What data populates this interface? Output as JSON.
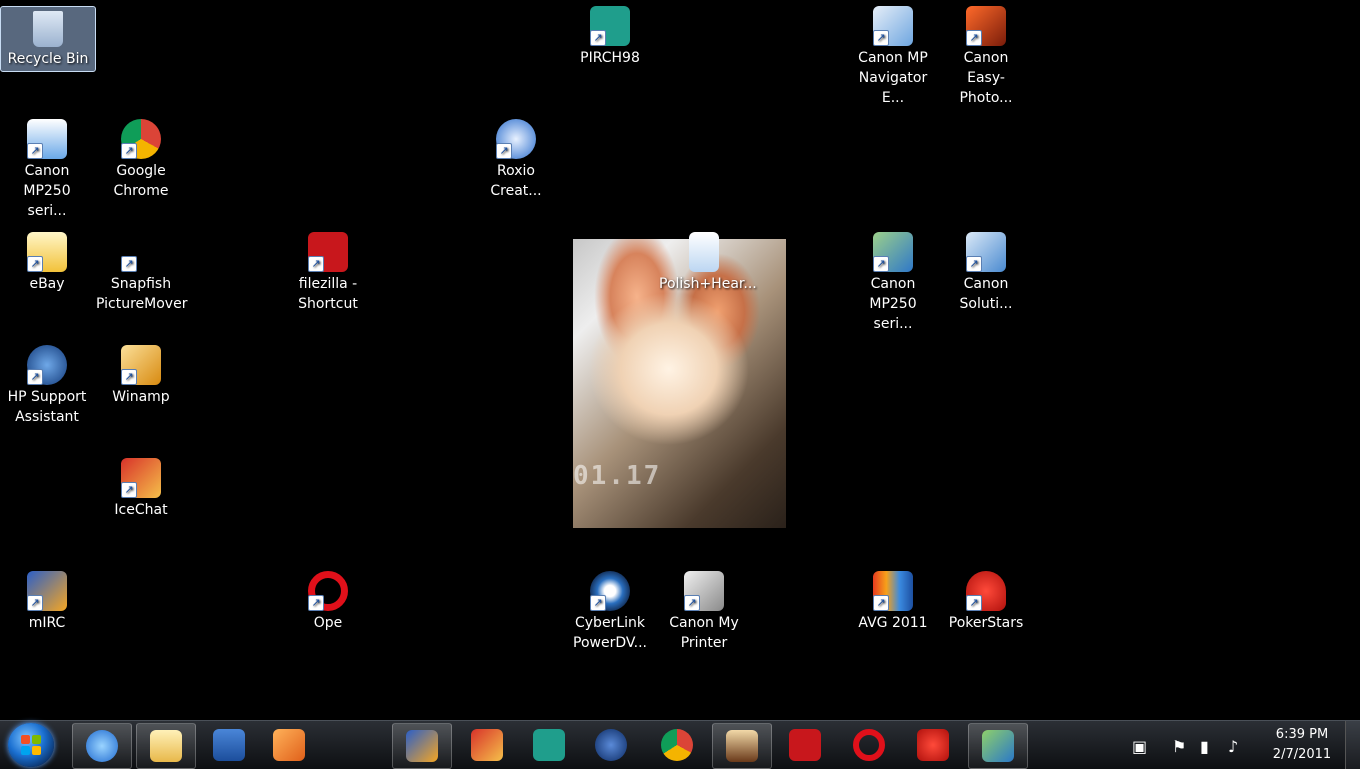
{
  "desktop": {
    "icons": [
      {
        "label": "Recycle Bin",
        "x": 0,
        "y": 0
      },
      {
        "label": "PIRCH98"
      },
      {
        "label": "Canon MP\nNavigator E..."
      },
      {
        "label": "Canon\nEasy-Photo..."
      },
      {
        "label": "Canon\nMP250 seri..."
      },
      {
        "label": "Google\nChrome"
      },
      {
        "label": "Roxio\nCreat..."
      },
      {
        "label": "eBay"
      },
      {
        "label": "Snapfish\nPictureMover"
      },
      {
        "label": "filezilla -\nShortcut"
      },
      {
        "label": "Polish+Hear..."
      },
      {
        "label": "Canon\nMP250 seri..."
      },
      {
        "label": "Canon\nSoluti..."
      },
      {
        "label": "HP Support\nAssistant"
      },
      {
        "label": "Winamp"
      },
      {
        "label": "IceChat"
      },
      {
        "label": "mIRC"
      },
      {
        "label": "Ope"
      },
      {
        "label": "CyberLink\nPowerDV..."
      },
      {
        "label": "Canon My\nPrinter"
      },
      {
        "label": "AVG 2011"
      },
      {
        "label": "PokerStars"
      }
    ],
    "photo_stamp": "01.17"
  },
  "taskbar": {
    "clock_time": "6:39 PM",
    "clock_date": "2/7/2011"
  },
  "colors": {
    "desktop_bg": "#000000",
    "selection": "#a0bee6",
    "taskbar": "#1b1e22"
  }
}
